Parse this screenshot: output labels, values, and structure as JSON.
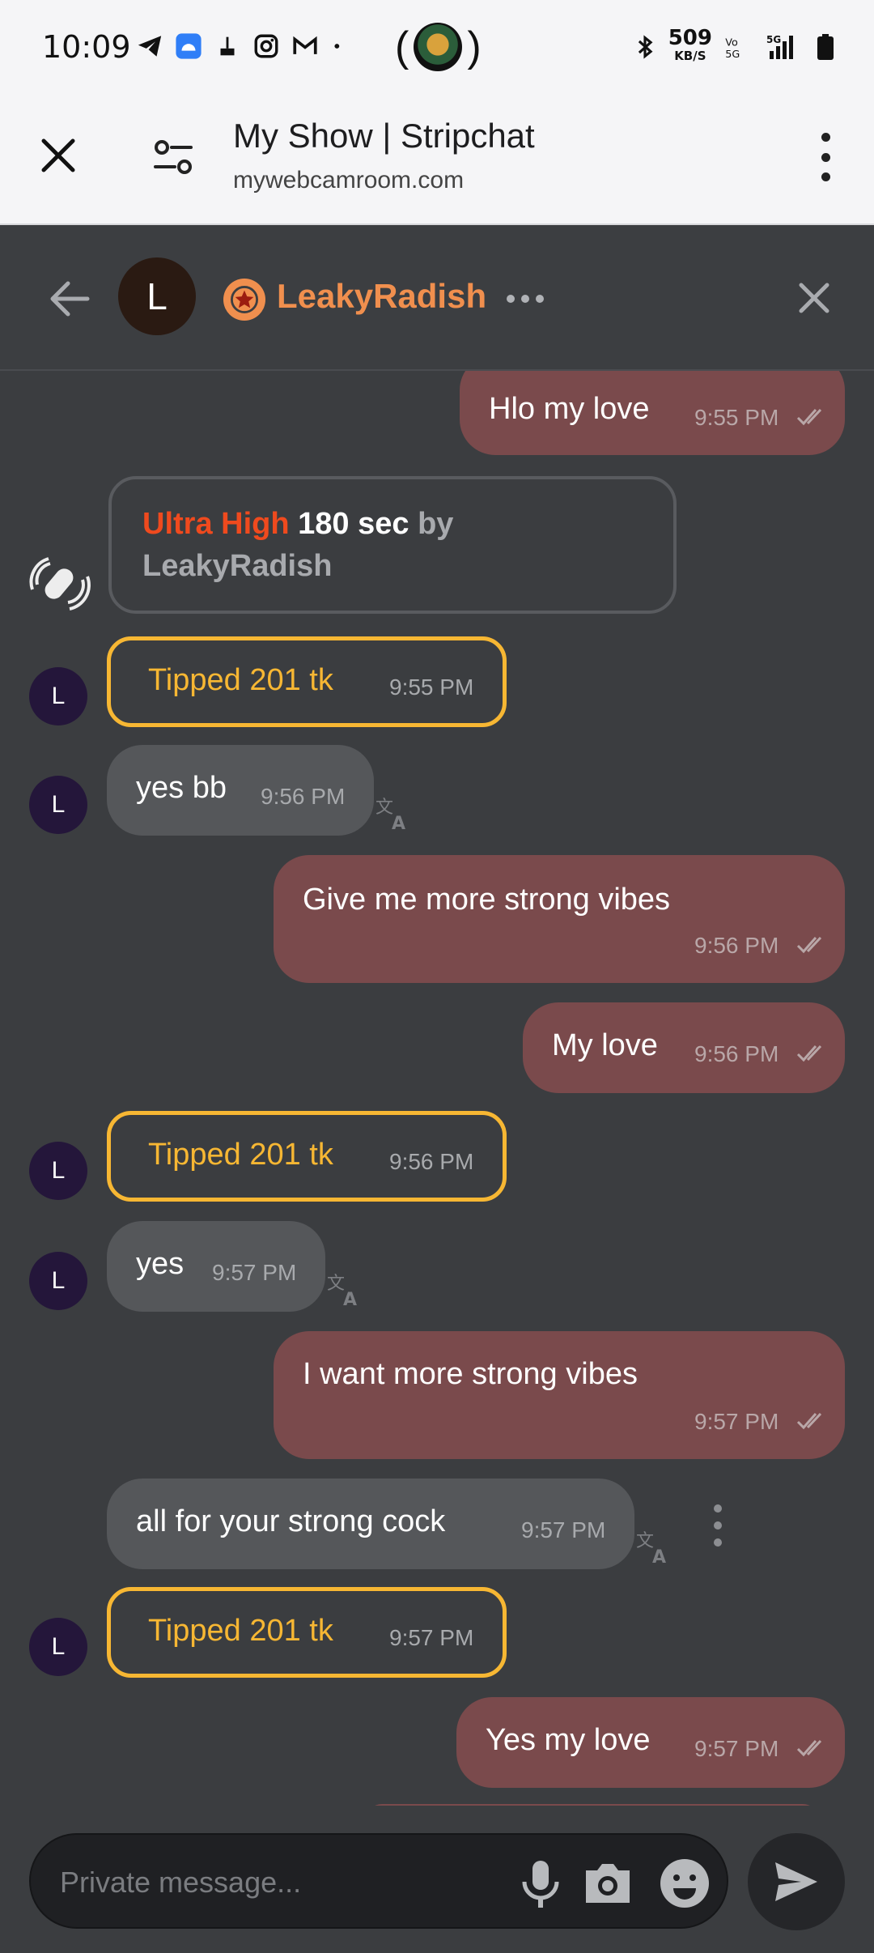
{
  "status_bar": {
    "time": "10:09",
    "speed_value": "509",
    "speed_unit": "KB/S",
    "network": "5G"
  },
  "browser": {
    "title": "My Show | Stripchat",
    "url": "mywebcamroom.com"
  },
  "chat_header": {
    "avatar_letter": "L",
    "username": "LeakyRadish"
  },
  "ultra_card": {
    "level": "Ultra High",
    "duration": "180 sec",
    "by": "by",
    "user": "LeakyRadish"
  },
  "messages": [
    {
      "kind": "out",
      "text": "Hlo my love",
      "time": "9:55 PM"
    },
    {
      "kind": "tip",
      "text": "Tipped 201 tk",
      "time": "9:55 PM",
      "avatar": "L"
    },
    {
      "kind": "in",
      "text": "yes bb",
      "time": "9:56 PM",
      "avatar": "L"
    },
    {
      "kind": "out",
      "text": "Give me more strong vibes",
      "time": "9:56 PM"
    },
    {
      "kind": "out",
      "text": "My love",
      "time": "9:56 PM"
    },
    {
      "kind": "tip",
      "text": "Tipped 201 tk",
      "time": "9:56 PM",
      "avatar": "L"
    },
    {
      "kind": "in",
      "text": "yes",
      "time": "9:57 PM",
      "avatar": "L"
    },
    {
      "kind": "out",
      "text": "I want more strong vibes",
      "time": "9:57 PM"
    },
    {
      "kind": "in",
      "text": "all for your strong cock",
      "time": "9:57 PM"
    },
    {
      "kind": "tip",
      "text": "Tipped 201 tk",
      "time": "9:57 PM",
      "avatar": "L"
    },
    {
      "kind": "out",
      "text": "Yes my love",
      "time": "9:57 PM"
    }
  ],
  "composer": {
    "placeholder": "Private message..."
  },
  "colors": {
    "accent_orange": "#f08f4e",
    "tip_gold": "#f7b733",
    "outgoing_bubble": "#7a4a4c",
    "incoming_bubble": "#55575a",
    "ultra_red": "#ef4a1e"
  },
  "icons": [
    "close-icon",
    "tune-icon",
    "menu-icon",
    "back-arrow-icon",
    "star-badge-icon",
    "more-dots-icon",
    "vibration-icon",
    "double-check-icon",
    "translate-icon",
    "mic-icon",
    "camera-icon",
    "emoji-icon",
    "send-icon"
  ]
}
